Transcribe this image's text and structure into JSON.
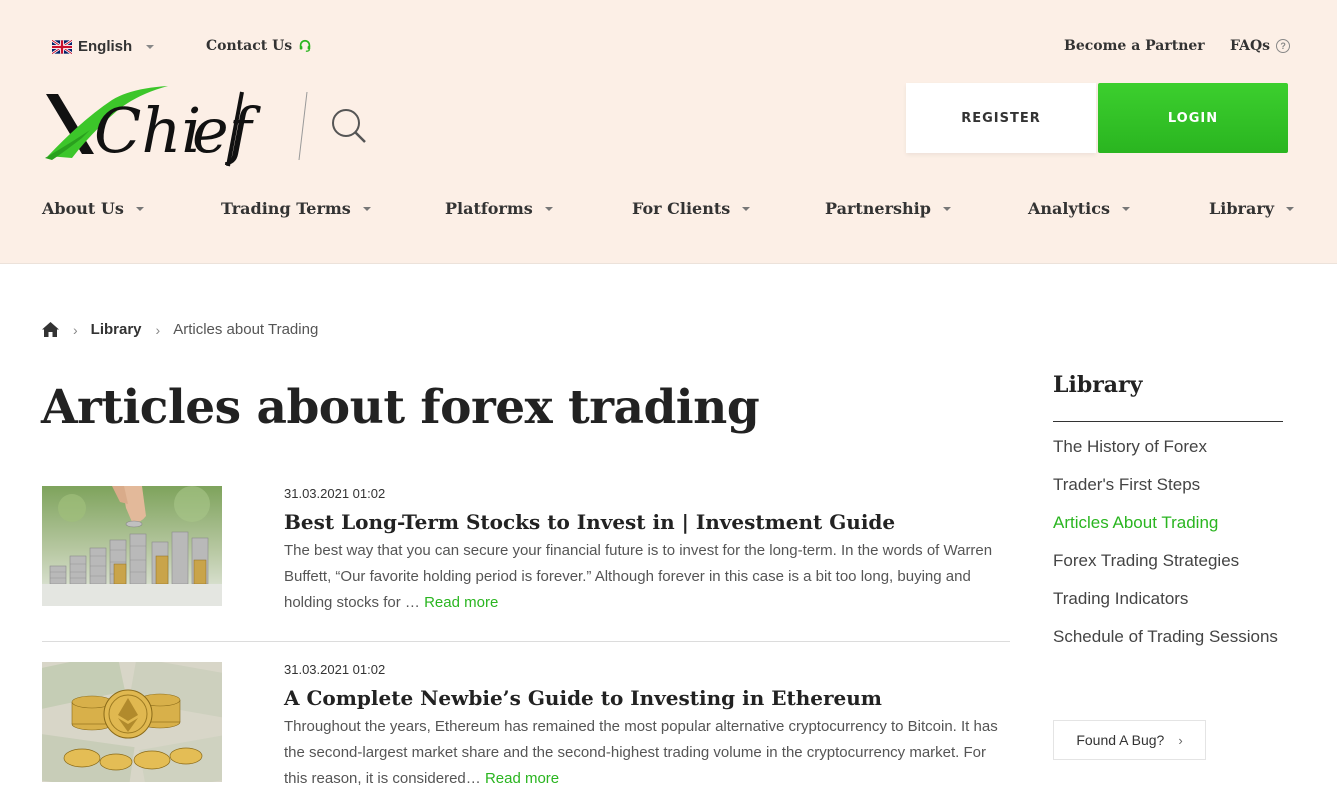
{
  "topbar": {
    "language": "English",
    "contact": "Contact Us",
    "partner": "Become a Partner",
    "faqs": "FAQs",
    "faqs_icon": "?"
  },
  "header": {
    "logo_alt": "XChief",
    "register": "REGISTER",
    "login": "LOGIN"
  },
  "nav": {
    "items": [
      "About Us",
      "Trading Terms",
      "Platforms",
      "For Clients",
      "Partnership",
      "Analytics",
      "Library"
    ]
  },
  "breadcrumb": {
    "separator": "›",
    "library": "Library",
    "current": "Articles about Trading"
  },
  "page": {
    "title": "Articles about forex trading"
  },
  "articles": [
    {
      "date": "31.03.2021 01:02",
      "title": "Best Long-Term Stocks to Invest in | Investment Guide",
      "excerpt": "The best way that you can secure your financial future is to invest for the long-term. In the words of Warren Buffett, “Our favorite holding period is forever.” Although forever in this case is a bit too long, buying and holding stocks for …",
      "read_more": "Read more"
    },
    {
      "date": "31.03.2021 01:02",
      "title": "A Complete Newbie’s Guide to Investing in Ethereum",
      "excerpt": "Throughout the years, Ethereum has remained the most popular alternative cryptocurrency to Bitcoin. It has the second-largest market share and the second-highest trading volume in the cryptocurrency market. For this reason, it is considered…",
      "read_more": "Read more"
    }
  ],
  "sidebar": {
    "title": "Library",
    "items": [
      {
        "label": "The History of Forex",
        "active": false
      },
      {
        "label": "Trader's First Steps",
        "active": false
      },
      {
        "label": "Articles About Trading",
        "active": true
      },
      {
        "label": "Forex Trading Strategies",
        "active": false
      },
      {
        "label": "Trading Indicators",
        "active": false
      },
      {
        "label": "Schedule of Trading Sessions",
        "active": false
      }
    ],
    "bug_button": "Found A Bug?",
    "bug_chevron": "›"
  },
  "colors": {
    "header_bg": "#fcefe6",
    "accent_green": "#2ab520",
    "text_dark": "#222222"
  }
}
